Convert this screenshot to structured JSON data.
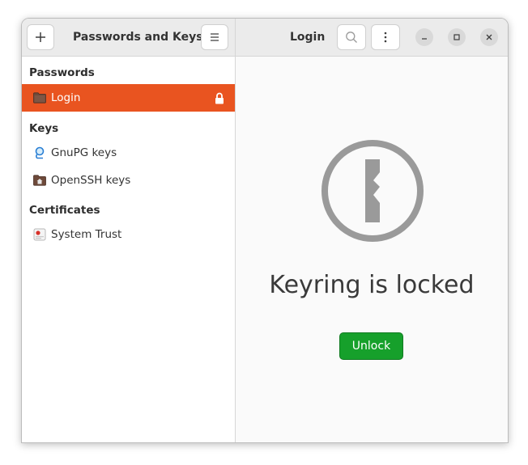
{
  "sidebar": {
    "header_title": "Passwords and Keys",
    "sections": [
      {
        "title": "Passwords",
        "items": [
          {
            "label": "Login",
            "icon": "folder-icon",
            "selected": true,
            "locked": true
          }
        ]
      },
      {
        "title": "Keys",
        "items": [
          {
            "label": "GnuPG keys",
            "icon": "gnupg-icon"
          },
          {
            "label": "OpenSSH keys",
            "icon": "home-folder-icon"
          }
        ]
      },
      {
        "title": "Certificates",
        "items": [
          {
            "label": "System Trust",
            "icon": "certificate-icon"
          }
        ]
      }
    ]
  },
  "main": {
    "header_title": "Login",
    "message": "Keyring is locked",
    "unlock_label": "Unlock"
  },
  "colors": {
    "accent": "#e95420",
    "unlock_button": "#16a02b",
    "lock_icon": "#9a9a9a"
  }
}
